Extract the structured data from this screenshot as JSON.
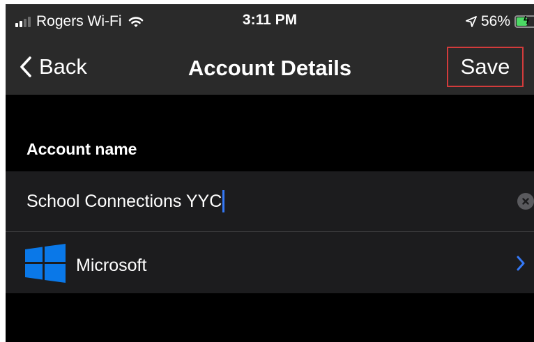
{
  "status_bar": {
    "carrier": "Rogers Wi-Fi",
    "time": "3:11 PM",
    "battery_percent": "56%",
    "battery_level": 0.56,
    "icons": [
      "signal-icon",
      "wifi-icon",
      "location-arrow-icon",
      "battery-charging-icon"
    ]
  },
  "nav": {
    "back_label": "Back",
    "title": "Account Details",
    "save_label": "Save",
    "highlight_color": "#d23b3b"
  },
  "account": {
    "section_label": "Account name",
    "name_value": "School Connections YYC",
    "clear_icon": "clear-x-icon"
  },
  "provider": {
    "label": "Microsoft",
    "icon": "windows-logo-icon",
    "logo_color": "#0a78e8",
    "chevron_color": "#3478f6"
  }
}
